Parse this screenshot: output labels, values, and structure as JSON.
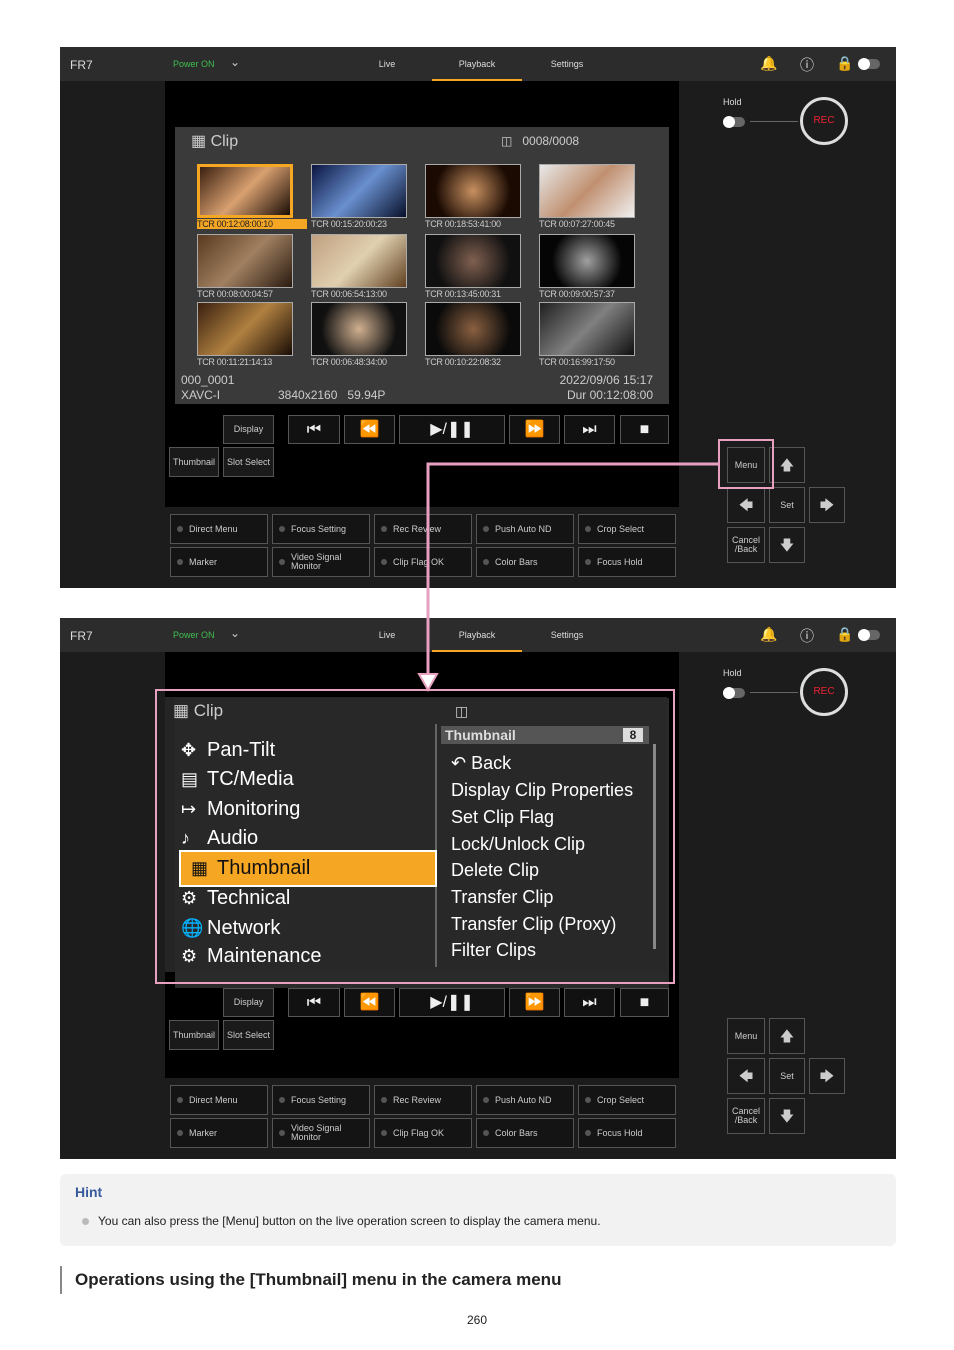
{
  "topbar": {
    "device": "FR7",
    "power": "Power ON",
    "tabs": [
      "Live",
      "Playback",
      "Settings"
    ]
  },
  "hold_label": "Hold",
  "rec_label": "REC",
  "clip": {
    "title": "Clip",
    "counter": "0008/0008",
    "thumbs": [
      "TCR 00:12:08:00:10",
      "TCR 00:15:20:00:23",
      "TCR 00:18:53:41:00",
      "TCR 00:07:27:00:45",
      "TCR 00:08:00:04:57",
      "TCR 00:06:54:13:00",
      "TCR 00:13:45:00:31",
      "TCR 00:09:00:57:37",
      "TCR 00:11:21:14:13",
      "TCR 00:06:48:34:00",
      "TCR 00:10:22:08:32",
      "TCR 00:16:99:17:50"
    ],
    "info": {
      "name": "000_0001",
      "codec": "XAVC-I",
      "format": "3840x2160   59.94P",
      "date": "2022/09/06 15:17",
      "dur": "Dur 00:12:08:00"
    }
  },
  "controls": {
    "display": "Display",
    "thumbnail": "Thumbnail",
    "slot": "Slot Select",
    "menu": "Menu",
    "set": "Set",
    "cancel": "Cancel /Back"
  },
  "function_buttons": [
    "Direct Menu",
    "Focus Setting",
    "Rec Review",
    "Push Auto ND",
    "Crop Select",
    "Marker",
    "Video Signal Monitor",
    "Clip Flag OK",
    "Color Bars",
    "Focus Hold"
  ],
  "camera_menu": {
    "left": [
      "Pan-Tilt",
      "TC/Media",
      "Monitoring",
      "Audio",
      "Thumbnail",
      "Technical",
      "Network",
      "Maintenance"
    ],
    "sub_title": "Thumbnail",
    "sub_count": "8",
    "right": [
      "Back",
      "Display Clip Properties",
      "Set Clip Flag",
      "Lock/Unlock Clip",
      "Delete Clip",
      "Transfer Clip",
      "Transfer Clip (Proxy)",
      "Filter Clips"
    ]
  },
  "hint": {
    "title": "Hint",
    "text": "You can also press the [Menu] button on the live operation screen to display the camera menu."
  },
  "heading": "Operations using the [Thumbnail] menu in the camera menu",
  "page_number": "260"
}
